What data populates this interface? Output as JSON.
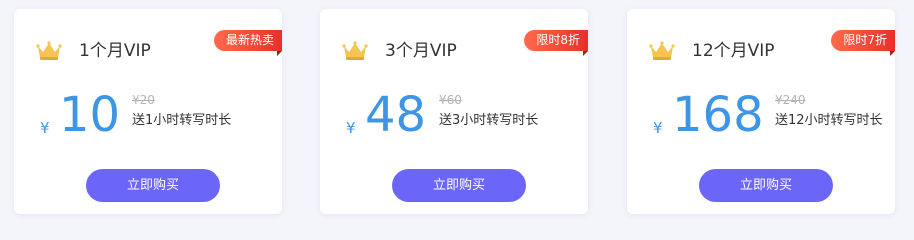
{
  "colors": {
    "accent_price": "#3d95e6",
    "button": "#6b66f7",
    "badge": "#e8302a",
    "crown": "#f5c452"
  },
  "plans": [
    {
      "title": "1个月VIP",
      "badge": "最新热卖",
      "currency": "¥",
      "price": "10",
      "original_price": "¥20",
      "gift": "送1小时转写时长",
      "button_label": "立即购买",
      "icon": "crown-icon"
    },
    {
      "title": "3个月VIP",
      "badge": "限时8折",
      "currency": "¥",
      "price": "48",
      "original_price": "¥60",
      "gift": "送3小时转写时长",
      "button_label": "立即购买",
      "icon": "crown-icon"
    },
    {
      "title": "12个月VIP",
      "badge": "限时7折",
      "currency": "¥",
      "price": "168",
      "original_price": "¥240",
      "gift": "送12小时转写时长",
      "button_label": "立即购买",
      "icon": "crown-icon"
    }
  ]
}
